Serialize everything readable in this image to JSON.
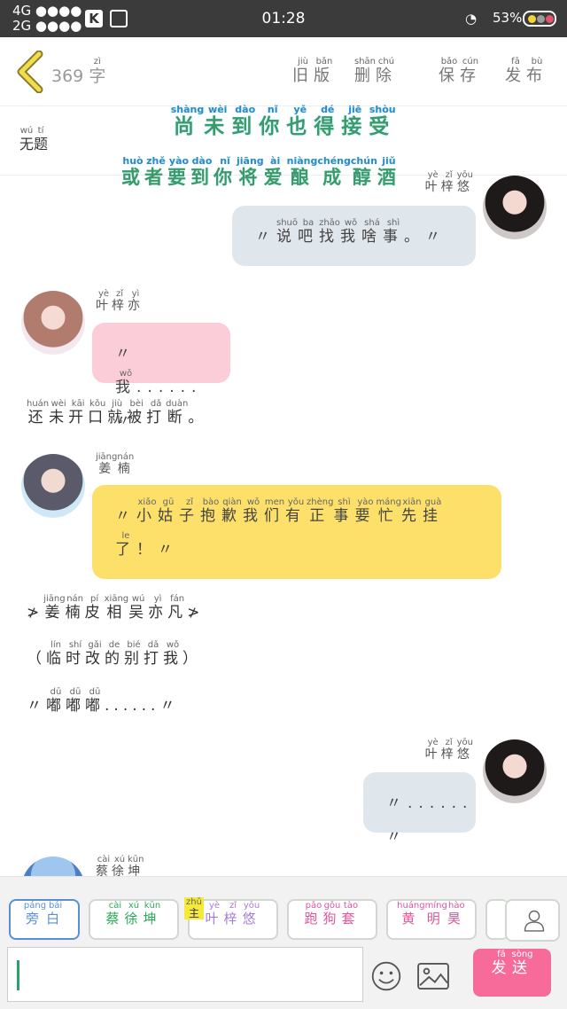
{
  "status": {
    "net1": "4G ●●●●",
    "net2": "2G ●●●●",
    "time": "01:28",
    "battery": "53%"
  },
  "header": {
    "count": "369",
    "count_unit": "字",
    "count_unit_py": "zì",
    "buttons": [
      {
        "text": "旧版",
        "py": [
          "jiù",
          "bǎn"
        ]
      },
      {
        "text": "删除",
        "py": [
          "shān",
          "chú"
        ]
      },
      {
        "text": "保存",
        "py": [
          "bǎo",
          "cún"
        ]
      },
      {
        "text": "发布",
        "py": [
          "fā",
          "bù"
        ]
      }
    ]
  },
  "title": {
    "text": "无题",
    "py": [
      "wú",
      "tí"
    ]
  },
  "overlay": {
    "line1": {
      "text": "尚未到你也得接受",
      "py": [
        "shàng",
        "wèi",
        "dào",
        "nǐ",
        "yě",
        "dé",
        "jiē",
        "shòu"
      ]
    },
    "line2": {
      "text": "或者要到你将爱酿成醇酒",
      "py": [
        "huò",
        "zhě",
        "yào",
        "dào",
        "nǐ",
        "jiāng",
        "ài",
        "niàng",
        "chéng",
        "chún",
        "jiǔ"
      ]
    }
  },
  "messages": [
    {
      "side": "right",
      "name": "叶梓悠",
      "name_py": [
        "yè",
        "zǐ",
        "yōu"
      ],
      "text": "〃说吧找我啥事。〃",
      "py": [
        "",
        "shuō",
        "ba",
        "zhǎo",
        "wǒ",
        "shá",
        "shì",
        "",
        ""
      ],
      "color": "#dfe6ec"
    },
    {
      "side": "left",
      "name": "叶梓亦",
      "name_py": [
        "yè",
        "zǐ",
        "yì"
      ],
      "text": "〃我......〃",
      "py": [
        "",
        "wǒ",
        "",
        "",
        "",
        "",
        "",
        ""
      ],
      "color": "#fbcdd9"
    },
    {
      "type": "narration",
      "text": "还未开口就被打断。",
      "py": [
        "huán",
        "wèi",
        "kāi",
        "kǒu",
        "jiù",
        "bèi",
        "dǎ",
        "duàn",
        ""
      ]
    },
    {
      "side": "left",
      "name": "姜楠",
      "name_py": [
        "jiāng",
        "nán"
      ],
      "text": "〃小姑子抱歉我们有正事要忙先挂了！〃",
      "py": [
        "",
        "xiǎo",
        "gū",
        "zǐ",
        "bào",
        "qiàn",
        "wǒ",
        "men",
        "yǒu",
        "zhèng",
        "shì",
        "yào",
        "máng",
        "xiān",
        "guà",
        "le",
        "",
        ""
      ],
      "color": "#fde06a"
    },
    {
      "type": "narration",
      "text": "≯姜楠皮相吴亦凡≯",
      "py": [
        "",
        "jiāng",
        "nán",
        "pí",
        "xiāng",
        "wú",
        "yì",
        "fán",
        ""
      ]
    },
    {
      "type": "narration",
      "text": "（临时改的别打我）",
      "py": [
        "",
        "lín",
        "shí",
        "gǎi",
        "de",
        "bié",
        "dǎ",
        "wǒ",
        ""
      ]
    },
    {
      "type": "narration",
      "text": "〃嘟嘟嘟......〃",
      "py": [
        "",
        "dū",
        "dū",
        "dū",
        "",
        "",
        "",
        "",
        "",
        "",
        ""
      ]
    },
    {
      "side": "right",
      "name": "叶梓悠",
      "name_py": [
        "yè",
        "zǐ",
        "yōu"
      ],
      "text": "〃......〃",
      "color": "#dfe6ec"
    },
    {
      "side": "left",
      "name": "蔡徐坤",
      "name_py": [
        "cài",
        "xú",
        "kūn"
      ]
    }
  ],
  "roles": [
    {
      "text": "旁白",
      "py": [
        "páng",
        "bái"
      ],
      "color": "#5a8fd6",
      "selected": true
    },
    {
      "text": "蔡徐坤",
      "py": [
        "cài",
        "xú",
        "kūn"
      ],
      "color": "#2ca85a"
    },
    {
      "text": "叶梓悠",
      "py": [
        "yè",
        "zǐ",
        "yōu"
      ],
      "color": "#a67bd6",
      "badge": "主",
      "badge_py": "zhǔ"
    },
    {
      "text": "跑狗套",
      "py": [
        "pǎo",
        "gǒu",
        "tào"
      ],
      "color": "#e2559b"
    },
    {
      "text": "黄明昊",
      "py": [
        "huáng",
        "míng",
        "hào"
      ],
      "color": "#e2559b"
    }
  ],
  "send": {
    "text": "发送",
    "py": [
      "fā",
      "sòng"
    ]
  }
}
